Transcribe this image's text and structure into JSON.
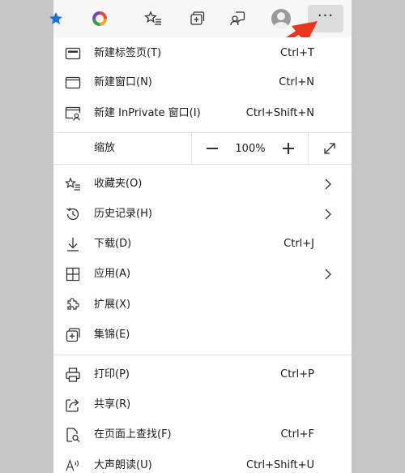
{
  "toolbar": {
    "icons": [
      "favorite-star-icon",
      "office-logo-icon",
      "favorites-icon",
      "collections-icon",
      "feedback-icon",
      "profile-avatar-icon",
      "more-menu-icon"
    ],
    "more_label": "···"
  },
  "menu": {
    "new_tab": {
      "label": "新建标签页(T)",
      "shortcut": "Ctrl+T"
    },
    "new_window": {
      "label": "新建窗口(N)",
      "shortcut": "Ctrl+N"
    },
    "new_private": {
      "label": "新建 InPrivate 窗口(I)",
      "shortcut": "Ctrl+Shift+N"
    },
    "zoom": {
      "label": "缩放",
      "value": "100%"
    },
    "favorites": {
      "label": "收藏夹(O)"
    },
    "history": {
      "label": "历史记录(H)"
    },
    "downloads": {
      "label": "下载(D)",
      "shortcut": "Ctrl+J"
    },
    "apps": {
      "label": "应用(A)"
    },
    "extensions": {
      "label": "扩展(X)"
    },
    "collections": {
      "label": "集锦(E)"
    },
    "print": {
      "label": "打印(P)",
      "shortcut": "Ctrl+P"
    },
    "share": {
      "label": "共享(R)"
    },
    "find": {
      "label": "在页面上查找(F)",
      "shortcut": "Ctrl+F"
    },
    "read_aloud": {
      "label": "大声朗读(U)",
      "shortcut": "Ctrl+Shift+U"
    }
  },
  "colors": {
    "background": "#c6c6c6",
    "toolbar": "#f7f7f7",
    "menu": "#ffffff",
    "arrow_annotation": "#e8361f",
    "favorite_star": "#1a73d9"
  }
}
